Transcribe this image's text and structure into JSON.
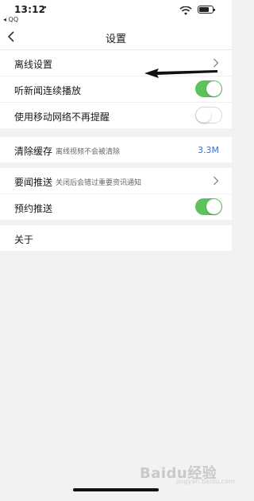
{
  "status_bar": {
    "time": "13:12",
    "location_glyph": "➚",
    "back_app": "◂ QQ",
    "battery_level": 0.75
  },
  "nav": {
    "title": "设置",
    "back_icon": "chevron-left-icon"
  },
  "section1": {
    "offline": "离线设置",
    "continuous_play": "听新闻连续播放",
    "continuous_play_on": true,
    "mobile_remind": "使用移动网络不再提醒",
    "mobile_remind_on": false
  },
  "section2": {
    "clear_cache": "清除缓存",
    "clear_cache_sub": "离线视频不会被清除",
    "cache_size": "3.3M"
  },
  "section3": {
    "push": "要闻推送",
    "push_sub": "关闭后会错过重要资讯通知",
    "scheduled_push": "预约推送",
    "scheduled_push_on": true
  },
  "section4": {
    "about": "关于"
  },
  "watermark": {
    "brand": "Baidu经验",
    "url": "jingyan.baidu.com"
  },
  "colors": {
    "toggle_on": "#5cc25c",
    "value_blue": "#3a6fd0",
    "background": "#f2f2f2"
  }
}
